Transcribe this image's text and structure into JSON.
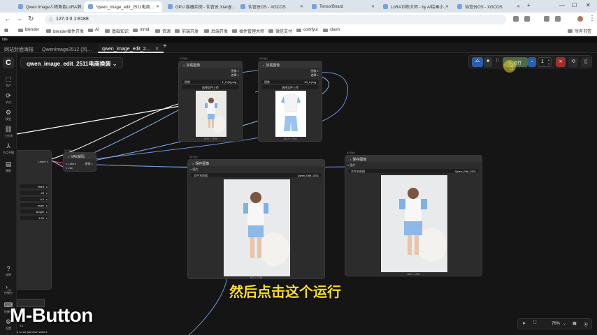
{
  "browser": {
    "tabs": [
      {
        "label": "Qwen Image人物角色LoRA训…",
        "active": false
      },
      {
        "label": "*qwen_image_edit_2511电商…",
        "active": true
      },
      {
        "label": "GPU 容器实例 - 仙宫云 Xiang…",
        "active": false
      },
      {
        "label": "仙宫云OS - XGCOS",
        "active": false
      },
      {
        "label": "TensorBoard",
        "active": false
      },
      {
        "label": "LoRA训练大师 - by AI绘画小…",
        "active": false
      },
      {
        "label": "仙宫云OS - XGCOS",
        "active": false
      }
    ],
    "url": "127.0.0.1:8188",
    "bookmarks": [
      "blender",
      "blender插件开发",
      "AI",
      "基础知识",
      "mmd",
      "资源",
      "前端开发",
      "后端开发",
      "插件管理大师",
      "微信支付",
      "comfyui",
      "clash"
    ],
    "all_bookmarks": "所有书签"
  },
  "app": {
    "title": "Idle",
    "workflow_tabs": [
      {
        "label": "网站封面海报",
        "active": false
      },
      {
        "label": "QwenImage2512 (风…",
        "active": false
      },
      {
        "label": "qwen_image_edit_2…",
        "active": true
      }
    ],
    "workflow_name": "qwen_image_edit_2511电商换装",
    "sidebar": [
      {
        "icon": "cube-icon",
        "label": "资产"
      },
      {
        "icon": "nodes-icon",
        "label": "节点"
      },
      {
        "icon": "model-icon",
        "label": "模型"
      },
      {
        "icon": "workflow-icon",
        "label": "工作流"
      },
      {
        "icon": "node-library-icon",
        "label": "节点书籍"
      },
      {
        "icon": "template-icon",
        "label": "模板"
      }
    ],
    "sidebar_bottom": [
      {
        "icon": "help-icon",
        "label": "说明"
      },
      {
        "icon": "console-icon",
        "label": "控制台"
      },
      {
        "icon": "shortcut-icon",
        "label": "快捷键"
      },
      {
        "icon": "settings-icon",
        "label": "设置"
      }
    ]
  },
  "nodes": {
    "load1": {
      "id": "#33(#)",
      "title": "加载图像",
      "out_image": "图像",
      "out_mask": "遮罩",
      "image_label": "图像",
      "image_value": "1_0 (5).png",
      "upload": "选择文件上传",
      "dims": "1024 × 1536"
    },
    "load2": {
      "id": "#34(#)",
      "title": "加载图像",
      "out_image": "图像",
      "out_mask": "遮罩",
      "image_label": "图像",
      "image_value": "10_2.png",
      "upload": "选择文件上传",
      "dims": "1024 × 1536"
    },
    "vae": {
      "id": "#18(#)",
      "title": "VAE解码",
      "in_latent": "Latent",
      "in_vae": "vae",
      "out_image": "图像"
    },
    "save1": {
      "id": "#27(#)",
      "title": "保存图像",
      "in_image": "图片",
      "prefix_label": "文件名前缀",
      "prefix_value": "Qwen_Edit_2511",
      "dims": "832 × 1248"
    },
    "save2": {
      "id": "#26(#)",
      "title": "保存图像",
      "in_image": "图片",
      "prefix_label": "文件名前缀",
      "prefix_value": "Qwen_Edit_2511",
      "dims": "832 × 1248"
    },
    "sampler": {
      "latent_out": "Latent",
      "values": [
        "fixed",
        "40",
        "4.0",
        "euler",
        "simple",
        "1.00"
      ]
    }
  },
  "toolbar": {
    "run_label": "运行",
    "count": "1",
    "zoom": "76%"
  },
  "overlay": {
    "subtitle": "然后点击这个运行",
    "mbutton": "M-Button",
    "left_fragment_1": "1:1",
    "left_fragment_2": "p so we just don't want it"
  },
  "colors": {
    "link": "#6f93d9",
    "link_white": "#ffffff",
    "run_green": "#4e6a43",
    "run_blue": "#2a5fa7",
    "subtitle": "#f7dc2c"
  }
}
